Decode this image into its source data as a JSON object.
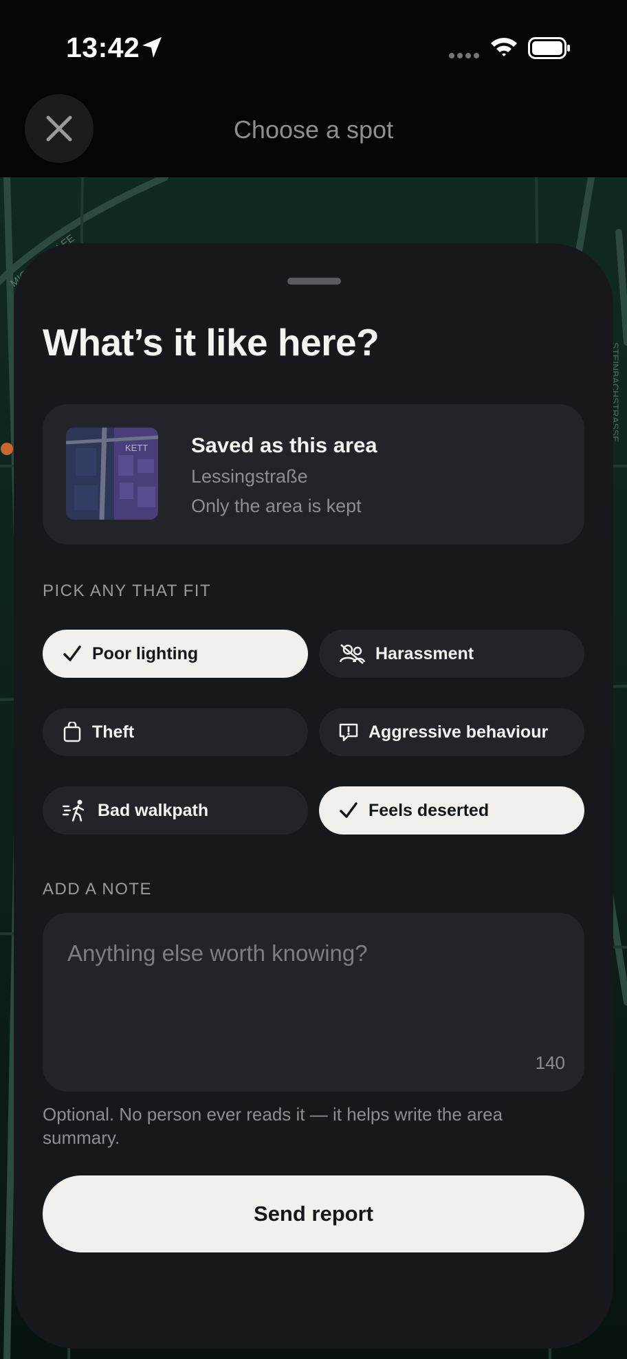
{
  "status_bar": {
    "time": "13:42"
  },
  "header": {
    "title": "Choose a spot",
    "close_icon": "close-icon"
  },
  "map": {
    "street_labels": [
      "MICHAELALLEE",
      "STEINBACHSTRASSE",
      "KETT"
    ]
  },
  "sheet": {
    "title": "What’s it like here?",
    "area": {
      "title": "Saved as this area",
      "street": "Lessingstraße",
      "note": "Only the area is kept",
      "thumb_label": "KETT"
    },
    "tags_label": "PICK ANY THAT FIT",
    "tags": [
      {
        "label": "Poor lighting",
        "icon": "check-icon",
        "selected": true
      },
      {
        "label": "Harassment",
        "icon": "person-slash-icon",
        "selected": false
      },
      {
        "label": "Theft",
        "icon": "bag-icon",
        "selected": false
      },
      {
        "label": "Aggressive behaviour",
        "icon": "alert-bubble-icon",
        "selected": false
      },
      {
        "label": "Bad walkpath",
        "icon": "walking-icon",
        "selected": false
      },
      {
        "label": "Feels deserted",
        "icon": "check-icon",
        "selected": true
      }
    ],
    "note_label": "ADD A NOTE",
    "note": {
      "placeholder": "Anything else worth knowing?",
      "value": "",
      "remaining": "140"
    },
    "helper": "Optional. No person ever reads it — it helps write the area summary.",
    "submit_label": "Send report"
  },
  "colors": {
    "background": "#050505",
    "sheet": "#17181c",
    "card": "#22242a",
    "chip_selected": "#f1f0ec",
    "map": "#0f2a22"
  }
}
